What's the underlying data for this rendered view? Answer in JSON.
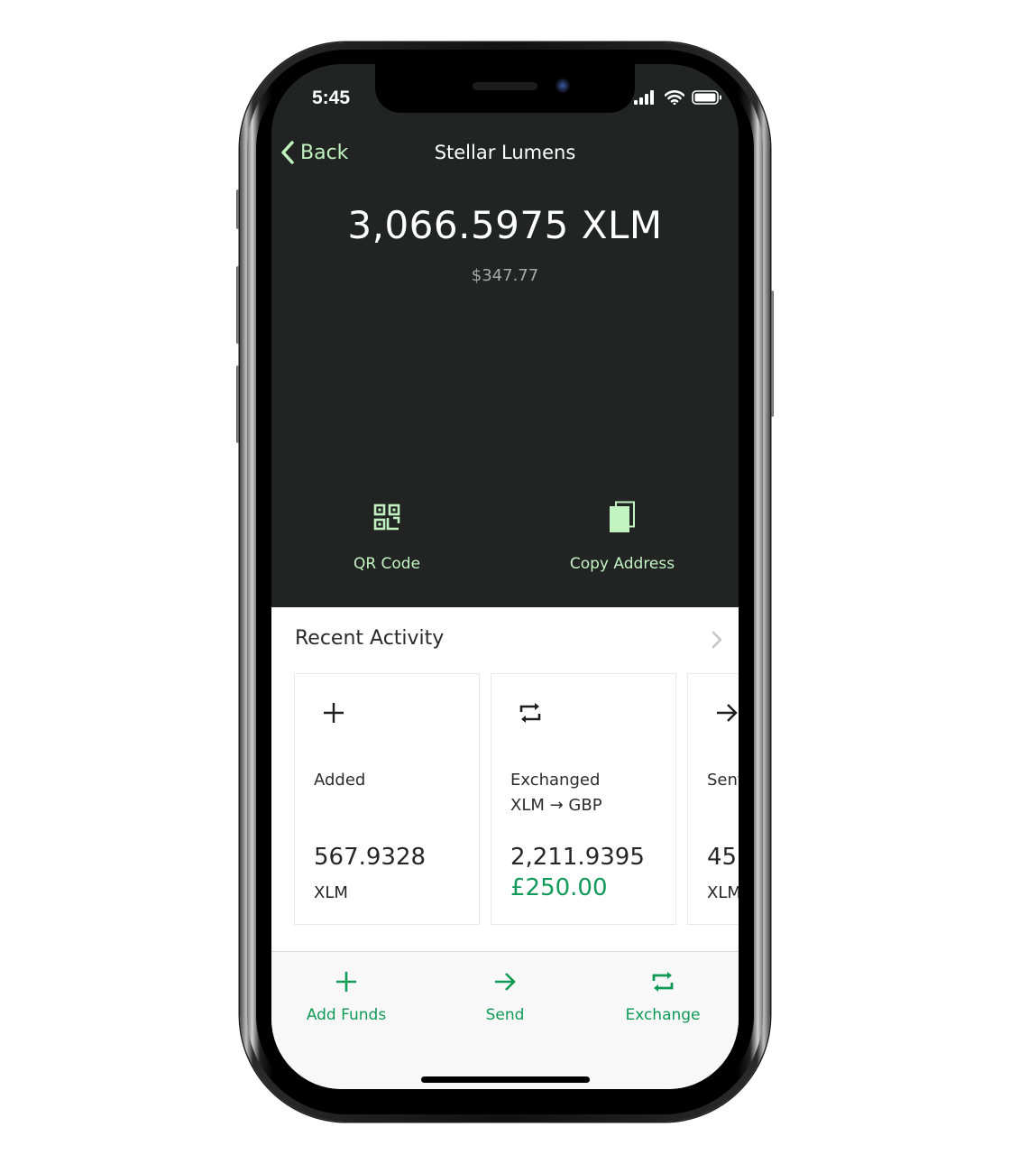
{
  "status_bar": {
    "time": "5:45"
  },
  "nav": {
    "back_label": "Back",
    "title": "Stellar Lumens"
  },
  "balance": {
    "amount": "3,066.5975 XLM",
    "fiat": "$347.77"
  },
  "quick_actions": [
    {
      "icon": "qr-code-icon",
      "label": "QR Code"
    },
    {
      "icon": "copy-icon",
      "label": "Copy Address"
    }
  ],
  "recent_activity": {
    "title": "Recent Activity",
    "items": [
      {
        "icon": "plus-icon",
        "title": "Added",
        "subtitle": "",
        "amount": "567.9328",
        "unit": "XLM",
        "fiat": ""
      },
      {
        "icon": "exchange-icon",
        "title": "Exchanged",
        "subtitle": "XLM → GBP",
        "amount": "2,211.9395",
        "unit": "",
        "fiat": "£250.00"
      },
      {
        "icon": "arrow-right-icon",
        "title": "Sent",
        "subtitle": "",
        "amount": "45",
        "unit": "XLM",
        "fiat": ""
      }
    ]
  },
  "bottom_actions": [
    {
      "icon": "plus-icon",
      "label": "Add Funds"
    },
    {
      "icon": "arrow-right-icon",
      "label": "Send"
    },
    {
      "icon": "exchange-icon",
      "label": "Exchange"
    }
  ],
  "colors": {
    "dark_bg": "#222423",
    "accent_light_green": "#c1f4c0",
    "accent_green": "#0f9a55",
    "panel_bg": "#ffffff",
    "bottom_bar_bg": "#f8f8f8"
  }
}
